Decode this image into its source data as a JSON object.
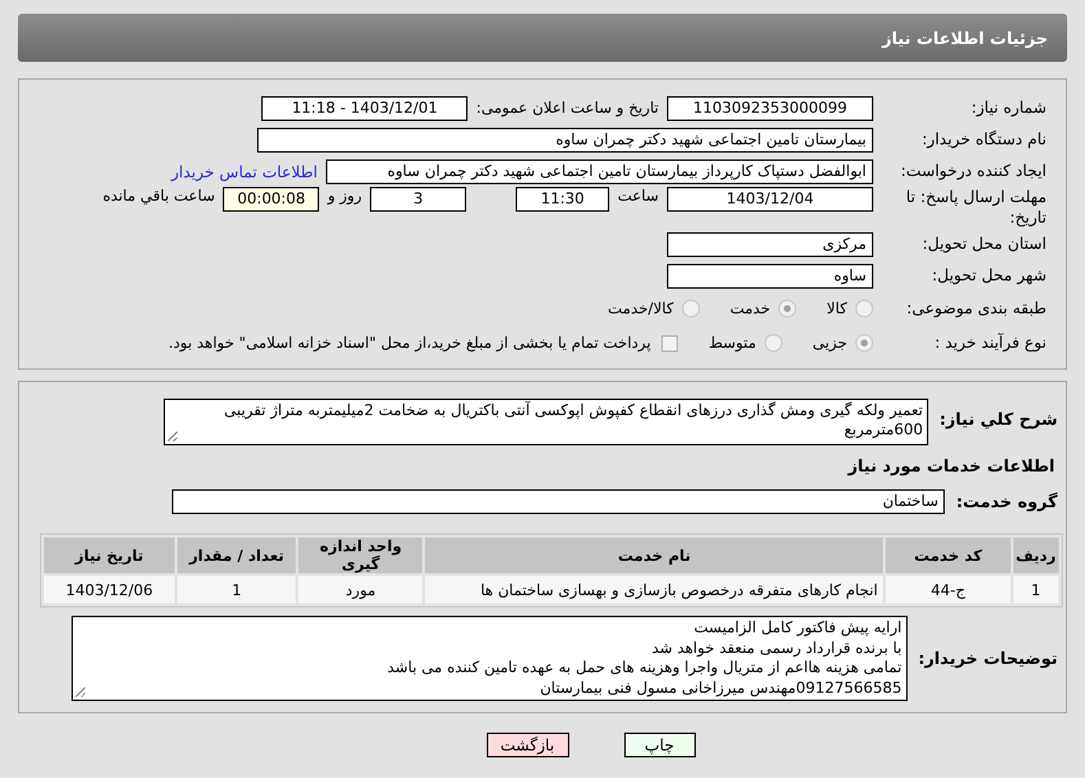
{
  "header": {
    "title": "جزئیات اطلاعات نیاز"
  },
  "need_number": {
    "label": "شماره نیاز:",
    "value": "1103092353000099"
  },
  "announce": {
    "label": "تاریخ و ساعت اعلان عمومی:",
    "value": "1403/12/01 - 11:18"
  },
  "buyer_org": {
    "label": "نام دستگاه خریدار:",
    "value": "بیمارستان تامین اجتماعی شهید دکتر چمران ساوه"
  },
  "creator": {
    "label": "ایجاد کننده درخواست:",
    "value": "ابوالفضل  دستپاک  کارپرداز بیمارستان تامین اجتماعی شهید دکتر چمران ساوه",
    "link": "اطلاعات تماس خریدار"
  },
  "deadline": {
    "label": "مهلت ارسال پاسخ: تا تاریخ:",
    "date": "1403/12/04",
    "time_label": "ساعت",
    "time": "11:30",
    "days": "3",
    "days_label": "روز و",
    "remaining": "00:00:08",
    "remaining_label": "ساعت باقي مانده"
  },
  "province": {
    "label": "استان محل تحویل:",
    "value": "مرکزی"
  },
  "city": {
    "label": "شهر محل تحویل:",
    "value": "ساوه"
  },
  "category": {
    "label": "طبقه بندی موضوعی:",
    "options": [
      {
        "label": "کالا",
        "selected": false
      },
      {
        "label": "خدمت",
        "selected": true
      },
      {
        "label": "کالا/خدمت",
        "selected": false
      }
    ]
  },
  "process": {
    "label": "نوع فرآیند خرید :",
    "options": [
      {
        "label": "جزیی",
        "selected": true
      },
      {
        "label": "متوسط",
        "selected": false
      }
    ],
    "checkbox": {
      "label": "پرداخت تمام یا بخشی از مبلغ خرید،از محل \"اسناد خزانه اسلامی\" خواهد بود.",
      "checked": false
    }
  },
  "description": {
    "label": "شرح کلي نياز:",
    "value": "تعمیر ولکه گیری ومش گذاری درزهای انقطاع کفپوش اپوکسی آنتی باکتریال به ضخامت 2میلیمتربه متراژ تقریبی 600مترمربع"
  },
  "services_heading": "اطلاعات خدمات مورد نیاز",
  "service_group": {
    "label": "گروه خدمت:",
    "value": "ساختمان"
  },
  "table": {
    "columns": [
      "ردیف",
      "کد خدمت",
      "نام خدمت",
      "واحد اندازه گیری",
      "تعداد / مقدار",
      "تاریخ نیاز"
    ],
    "rows": [
      [
        "1",
        "ج-44",
        "انجام کارهای متفرقه درخصوص بازسازی و بهسازی ساختمان ها",
        "مورد",
        "1",
        "1403/12/06"
      ]
    ]
  },
  "buyer_notes": {
    "label": "توضیحات خریدار:",
    "lines": [
      "ارایه پیش فاکتور کامل الزامیست",
      "با برنده قرارداد رسمی منعقد خواهد شد",
      "تمامی هزینه هااعم از متریال واجرا وهزینه های حمل به عهده تامین کننده می باشد",
      "09127566585مهندس میرزاخانی مسول فنی بیمارستان"
    ]
  },
  "buttons": [
    {
      "label": "چاپ",
      "kind": "print"
    },
    {
      "label": "بازگشت",
      "kind": "back"
    }
  ]
}
